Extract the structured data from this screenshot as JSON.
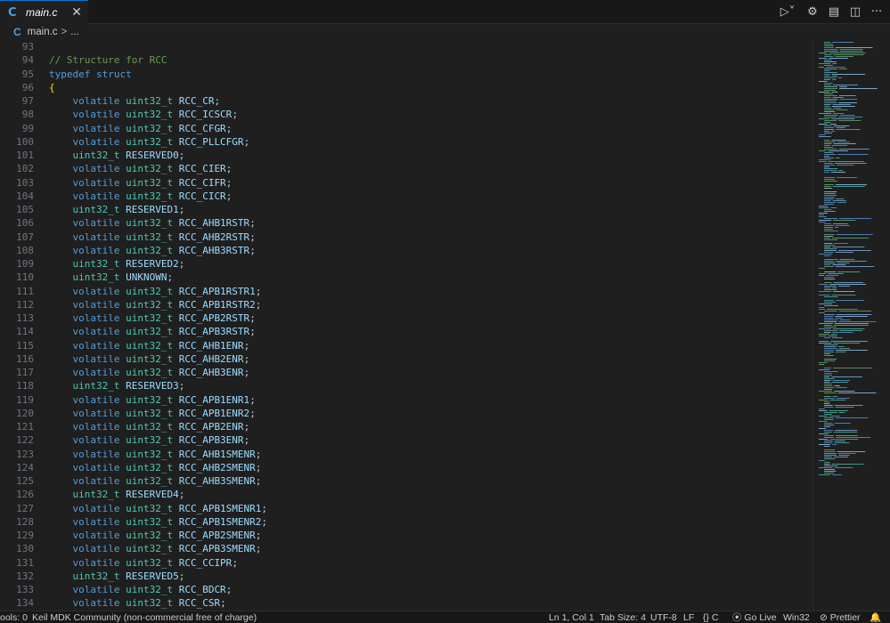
{
  "tab": {
    "icon": "c-file-icon",
    "icon_glyph": "C",
    "label": "main.c",
    "close": "✕"
  },
  "toolbar": {
    "run": "▷˅",
    "settings": "⚙",
    "layout": "▤",
    "split": "◫",
    "more": "···"
  },
  "breadcrumb": {
    "icon_glyph": "C",
    "file": "main.c",
    "separator": ">",
    "rest": "..."
  },
  "editor": {
    "colors": {
      "comment": "#6a9955",
      "keyword": "#569cd6",
      "type": "#4ec9b0",
      "identifier": "#9cdcfe",
      "brace": "#ffd700"
    },
    "lines": [
      {
        "n": "93",
        "tokens": []
      },
      {
        "n": "94",
        "tokens": [
          {
            "t": "c",
            "v": "// Structure for RCC"
          }
        ]
      },
      {
        "n": "95",
        "tokens": [
          {
            "t": "k",
            "v": "typedef struct"
          }
        ]
      },
      {
        "n": "96",
        "tokens": [
          {
            "t": "b",
            "v": "{"
          }
        ]
      },
      {
        "n": "97",
        "tokens": [
          {
            "t": "k",
            "v": "    volatile "
          },
          {
            "t": "y",
            "v": "uint32_t "
          },
          {
            "t": "i",
            "v": "RCC_CR"
          },
          {
            "t": "p",
            "v": ";"
          }
        ]
      },
      {
        "n": "98",
        "tokens": [
          {
            "t": "k",
            "v": "    volatile "
          },
          {
            "t": "y",
            "v": "uint32_t "
          },
          {
            "t": "i",
            "v": "RCC_ICSCR"
          },
          {
            "t": "p",
            "v": ";"
          }
        ]
      },
      {
        "n": "99",
        "tokens": [
          {
            "t": "k",
            "v": "    volatile "
          },
          {
            "t": "y",
            "v": "uint32_t "
          },
          {
            "t": "i",
            "v": "RCC_CFGR"
          },
          {
            "t": "p",
            "v": ";"
          }
        ]
      },
      {
        "n": "100",
        "tokens": [
          {
            "t": "k",
            "v": "    volatile "
          },
          {
            "t": "y",
            "v": "uint32_t "
          },
          {
            "t": "i",
            "v": "RCC_PLLCFGR"
          },
          {
            "t": "p",
            "v": ";"
          }
        ]
      },
      {
        "n": "101",
        "tokens": [
          {
            "t": "y",
            "v": "    uint32_t "
          },
          {
            "t": "i",
            "v": "RESERVED0"
          },
          {
            "t": "p",
            "v": ";"
          }
        ]
      },
      {
        "n": "102",
        "tokens": [
          {
            "t": "k",
            "v": "    volatile "
          },
          {
            "t": "y",
            "v": "uint32_t "
          },
          {
            "t": "i",
            "v": "RCC_CIER"
          },
          {
            "t": "p",
            "v": ";"
          }
        ]
      },
      {
        "n": "103",
        "tokens": [
          {
            "t": "k",
            "v": "    volatile "
          },
          {
            "t": "y",
            "v": "uint32_t "
          },
          {
            "t": "i",
            "v": "RCC_CIFR"
          },
          {
            "t": "p",
            "v": ";"
          }
        ]
      },
      {
        "n": "104",
        "tokens": [
          {
            "t": "k",
            "v": "    volatile "
          },
          {
            "t": "y",
            "v": "uint32_t "
          },
          {
            "t": "i",
            "v": "RCC_CICR"
          },
          {
            "t": "p",
            "v": ";"
          }
        ]
      },
      {
        "n": "105",
        "tokens": [
          {
            "t": "y",
            "v": "    uint32_t "
          },
          {
            "t": "i",
            "v": "RESERVED1"
          },
          {
            "t": "p",
            "v": ";"
          }
        ]
      },
      {
        "n": "106",
        "tokens": [
          {
            "t": "k",
            "v": "    volatile "
          },
          {
            "t": "y",
            "v": "uint32_t "
          },
          {
            "t": "i",
            "v": "RCC_AHB1RSTR"
          },
          {
            "t": "p",
            "v": ";"
          }
        ]
      },
      {
        "n": "107",
        "tokens": [
          {
            "t": "k",
            "v": "    volatile "
          },
          {
            "t": "y",
            "v": "uint32_t "
          },
          {
            "t": "i",
            "v": "RCC_AHB2RSTR"
          },
          {
            "t": "p",
            "v": ";"
          }
        ]
      },
      {
        "n": "108",
        "tokens": [
          {
            "t": "k",
            "v": "    volatile "
          },
          {
            "t": "y",
            "v": "uint32_t "
          },
          {
            "t": "i",
            "v": "RCC_AHB3RSTR"
          },
          {
            "t": "p",
            "v": ";"
          }
        ]
      },
      {
        "n": "109",
        "tokens": [
          {
            "t": "y",
            "v": "    uint32_t "
          },
          {
            "t": "i",
            "v": "RESERVED2"
          },
          {
            "t": "p",
            "v": ";"
          }
        ]
      },
      {
        "n": "110",
        "tokens": [
          {
            "t": "y",
            "v": "    uint32_t "
          },
          {
            "t": "i",
            "v": "UNKNOWN"
          },
          {
            "t": "p",
            "v": ";"
          }
        ]
      },
      {
        "n": "111",
        "tokens": [
          {
            "t": "k",
            "v": "    volatile "
          },
          {
            "t": "y",
            "v": "uint32_t "
          },
          {
            "t": "i",
            "v": "RCC_APB1RSTR1"
          },
          {
            "t": "p",
            "v": ";"
          }
        ]
      },
      {
        "n": "112",
        "tokens": [
          {
            "t": "k",
            "v": "    volatile "
          },
          {
            "t": "y",
            "v": "uint32_t "
          },
          {
            "t": "i",
            "v": "RCC_APB1RSTR2"
          },
          {
            "t": "p",
            "v": ";"
          }
        ]
      },
      {
        "n": "113",
        "tokens": [
          {
            "t": "k",
            "v": "    volatile "
          },
          {
            "t": "y",
            "v": "uint32_t "
          },
          {
            "t": "i",
            "v": "RCC_APB2RSTR"
          },
          {
            "t": "p",
            "v": ";"
          }
        ]
      },
      {
        "n": "114",
        "tokens": [
          {
            "t": "k",
            "v": "    volatile "
          },
          {
            "t": "y",
            "v": "uint32_t "
          },
          {
            "t": "i",
            "v": "RCC_APB3RSTR"
          },
          {
            "t": "p",
            "v": ";"
          }
        ]
      },
      {
        "n": "115",
        "tokens": [
          {
            "t": "k",
            "v": "    volatile "
          },
          {
            "t": "y",
            "v": "uint32_t "
          },
          {
            "t": "i",
            "v": "RCC_AHB1ENR"
          },
          {
            "t": "p",
            "v": ";"
          }
        ]
      },
      {
        "n": "116",
        "tokens": [
          {
            "t": "k",
            "v": "    volatile "
          },
          {
            "t": "y",
            "v": "uint32_t "
          },
          {
            "t": "i",
            "v": "RCC_AHB2ENR"
          },
          {
            "t": "p",
            "v": ";"
          }
        ]
      },
      {
        "n": "117",
        "tokens": [
          {
            "t": "k",
            "v": "    volatile "
          },
          {
            "t": "y",
            "v": "uint32_t "
          },
          {
            "t": "i",
            "v": "RCC_AHB3ENR"
          },
          {
            "t": "p",
            "v": ";"
          }
        ]
      },
      {
        "n": "118",
        "tokens": [
          {
            "t": "y",
            "v": "    uint32_t "
          },
          {
            "t": "i",
            "v": "RESERVED3"
          },
          {
            "t": "p",
            "v": ";"
          }
        ]
      },
      {
        "n": "119",
        "tokens": [
          {
            "t": "k",
            "v": "    volatile "
          },
          {
            "t": "y",
            "v": "uint32_t "
          },
          {
            "t": "i",
            "v": "RCC_APB1ENR1"
          },
          {
            "t": "p",
            "v": ";"
          }
        ]
      },
      {
        "n": "120",
        "tokens": [
          {
            "t": "k",
            "v": "    volatile "
          },
          {
            "t": "y",
            "v": "uint32_t "
          },
          {
            "t": "i",
            "v": "RCC_APB1ENR2"
          },
          {
            "t": "p",
            "v": ";"
          }
        ]
      },
      {
        "n": "121",
        "tokens": [
          {
            "t": "k",
            "v": "    volatile "
          },
          {
            "t": "y",
            "v": "uint32_t "
          },
          {
            "t": "i",
            "v": "RCC_APB2ENR"
          },
          {
            "t": "p",
            "v": ";"
          }
        ]
      },
      {
        "n": "122",
        "tokens": [
          {
            "t": "k",
            "v": "    volatile "
          },
          {
            "t": "y",
            "v": "uint32_t "
          },
          {
            "t": "i",
            "v": "RCC_APB3ENR"
          },
          {
            "t": "p",
            "v": ";"
          }
        ]
      },
      {
        "n": "123",
        "tokens": [
          {
            "t": "k",
            "v": "    volatile "
          },
          {
            "t": "y",
            "v": "uint32_t "
          },
          {
            "t": "i",
            "v": "RCC_AHB1SMENR"
          },
          {
            "t": "p",
            "v": ";"
          }
        ]
      },
      {
        "n": "124",
        "tokens": [
          {
            "t": "k",
            "v": "    volatile "
          },
          {
            "t": "y",
            "v": "uint32_t "
          },
          {
            "t": "i",
            "v": "RCC_AHB2SMENR"
          },
          {
            "t": "p",
            "v": ";"
          }
        ]
      },
      {
        "n": "125",
        "tokens": [
          {
            "t": "k",
            "v": "    volatile "
          },
          {
            "t": "y",
            "v": "uint32_t "
          },
          {
            "t": "i",
            "v": "RCC_AHB3SMENR"
          },
          {
            "t": "p",
            "v": ";"
          }
        ]
      },
      {
        "n": "126",
        "tokens": [
          {
            "t": "y",
            "v": "    uint32_t "
          },
          {
            "t": "i",
            "v": "RESERVED4"
          },
          {
            "t": "p",
            "v": ";"
          }
        ]
      },
      {
        "n": "127",
        "tokens": [
          {
            "t": "k",
            "v": "    volatile "
          },
          {
            "t": "y",
            "v": "uint32_t "
          },
          {
            "t": "i",
            "v": "RCC_APB1SMENR1"
          },
          {
            "t": "p",
            "v": ";"
          }
        ]
      },
      {
        "n": "128",
        "tokens": [
          {
            "t": "k",
            "v": "    volatile "
          },
          {
            "t": "y",
            "v": "uint32_t "
          },
          {
            "t": "i",
            "v": "RCC_APB1SMENR2"
          },
          {
            "t": "p",
            "v": ";"
          }
        ]
      },
      {
        "n": "129",
        "tokens": [
          {
            "t": "k",
            "v": "    volatile "
          },
          {
            "t": "y",
            "v": "uint32_t "
          },
          {
            "t": "i",
            "v": "RCC_APB2SMENR"
          },
          {
            "t": "p",
            "v": ";"
          }
        ]
      },
      {
        "n": "130",
        "tokens": [
          {
            "t": "k",
            "v": "    volatile "
          },
          {
            "t": "y",
            "v": "uint32_t "
          },
          {
            "t": "i",
            "v": "RCC_APB3SMENR"
          },
          {
            "t": "p",
            "v": ";"
          }
        ]
      },
      {
        "n": "131",
        "tokens": [
          {
            "t": "k",
            "v": "    volatile "
          },
          {
            "t": "y",
            "v": "uint32_t "
          },
          {
            "t": "i",
            "v": "RCC_CCIPR"
          },
          {
            "t": "p",
            "v": ";"
          }
        ]
      },
      {
        "n": "132",
        "tokens": [
          {
            "t": "y",
            "v": "    uint32_t "
          },
          {
            "t": "i",
            "v": "RESERVED5"
          },
          {
            "t": "p",
            "v": ";"
          }
        ]
      },
      {
        "n": "133",
        "tokens": [
          {
            "t": "k",
            "v": "    volatile "
          },
          {
            "t": "y",
            "v": "uint32_t "
          },
          {
            "t": "i",
            "v": "RCC_BDCR"
          },
          {
            "t": "p",
            "v": ";"
          }
        ]
      },
      {
        "n": "134",
        "tokens": [
          {
            "t": "k",
            "v": "    volatile "
          },
          {
            "t": "y",
            "v": "uint32_t "
          },
          {
            "t": "i",
            "v": "RCC_CSR"
          },
          {
            "t": "p",
            "v": ";"
          }
        ]
      }
    ]
  },
  "statusbar": {
    "tools": "ools: 0",
    "keil": "Keil MDK Community (non-commercial free of charge)",
    "position": "Ln 1, Col 1",
    "tab_size": "Tab Size: 4",
    "encoding": "UTF-8",
    "eol": "LF",
    "language": "{} C",
    "golive": "⦿ Go Live",
    "platform": "Win32",
    "prettier": "⊘ Prettier",
    "bell": "🔔"
  }
}
